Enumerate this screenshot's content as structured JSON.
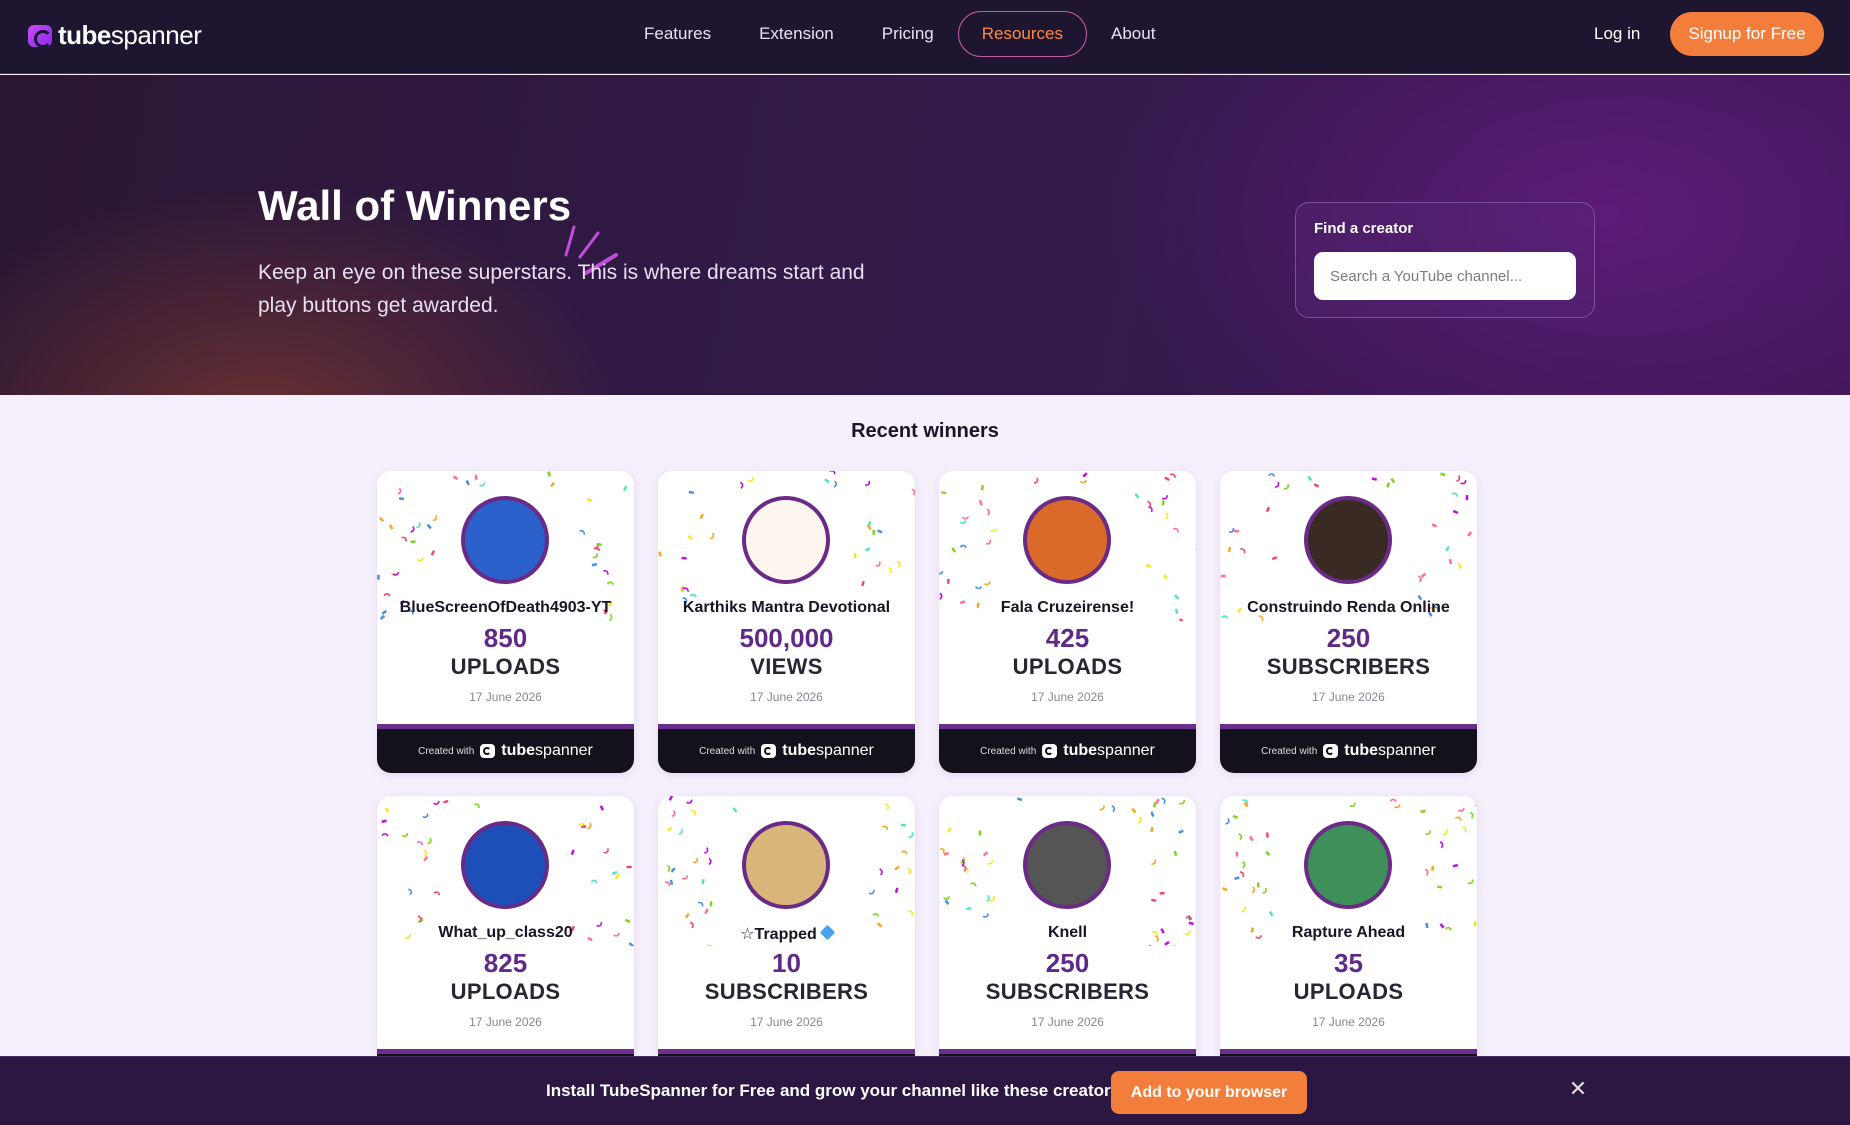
{
  "nav": {
    "logo_bold": "tube",
    "logo_light": "spanner",
    "links": [
      "Features",
      "Extension",
      "Pricing",
      "Resources",
      "About"
    ],
    "active_link": "Resources",
    "login": "Log in",
    "signup": "Signup for Free"
  },
  "hero": {
    "title": "Wall of Winners",
    "subtitle": "Keep an eye on these superstars. This is where dreams start and play buttons get awarded.",
    "finder_label": "Find a creator",
    "finder_placeholder": "Search a YouTube channel..."
  },
  "winners": {
    "title": "Recent winners",
    "footer_made": "Created with",
    "footer_brand_bold": "tube",
    "footer_brand_light": "spanner",
    "cards": [
      {
        "name": "BlueScreenOfDeath4903-YT",
        "value": "850",
        "metric": "UPLOADS",
        "date": "17 June 2026",
        "avatar_color": "#2b5fc9"
      },
      {
        "name": "Karthiks Mantra Devotional",
        "value": "500,000",
        "metric": "VIEWS",
        "date": "17 June 2026",
        "avatar_color": "#fdf6ee"
      },
      {
        "name": "Fala Cruzeirense!",
        "value": "425",
        "metric": "UPLOADS",
        "date": "17 June 2026",
        "avatar_color": "#d96a2a"
      },
      {
        "name": "Construindo Renda Online",
        "value": "250",
        "metric": "SUBSCRIBERS",
        "date": "17 June 2026",
        "avatar_color": "#3a2a24"
      },
      {
        "name": "What_up_class20",
        "value": "825",
        "metric": "UPLOADS",
        "date": "17 June 2026",
        "avatar_color": "#1d4fb8"
      },
      {
        "name": "☆Trapped",
        "value": "10",
        "metric": "SUBSCRIBERS",
        "date": "17 June 2026",
        "avatar_color": "#d9b77a",
        "verified": true
      },
      {
        "name": "Knell",
        "value": "250",
        "metric": "SUBSCRIBERS",
        "date": "17 June 2026",
        "avatar_color": "#555555"
      },
      {
        "name": "Rapture Ahead",
        "value": "35",
        "metric": "UPLOADS",
        "date": "17 June 2026",
        "avatar_color": "#3f8f5a"
      }
    ]
  },
  "banner": {
    "text": "Install TubeSpanner for Free and grow your channel like these creators.",
    "button": "Add to your browser",
    "close_icon": "close-icon"
  },
  "colors": {
    "accent_orange": "#f37e3b",
    "value_purple": "#5f2a87",
    "nav_bg": "#1e1530"
  }
}
